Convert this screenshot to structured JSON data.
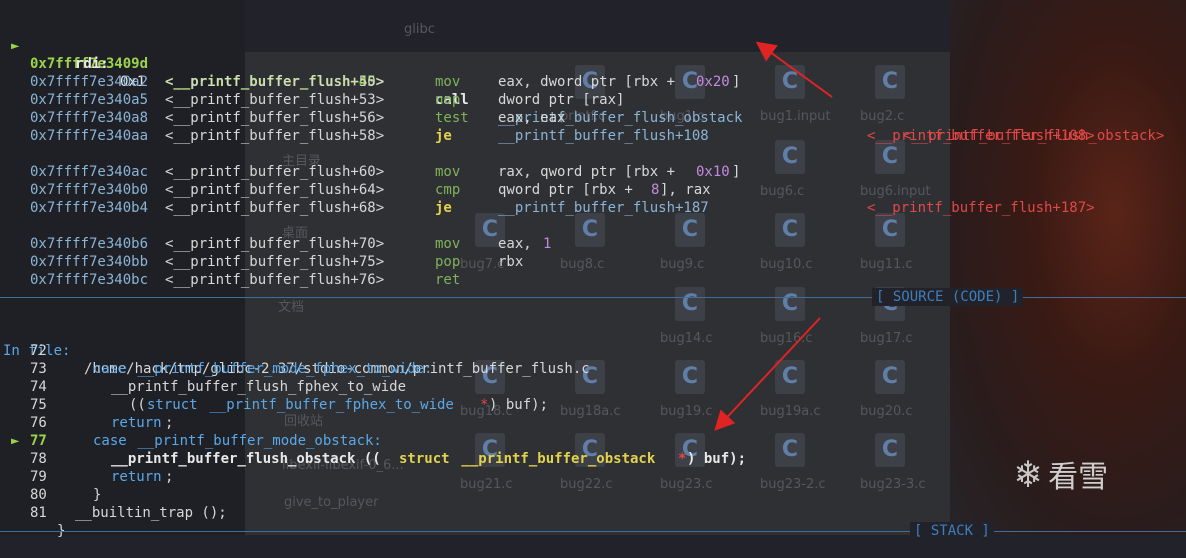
{
  "background": {
    "window_title": "glibc",
    "sidebar_items": [
      "最近使用",
      "主目录",
      "桌面",
      "文档",
      "回收站",
      "libexif-libexif-0_6...",
      "give_to_player"
    ],
    "files": [
      "printf.c",
      "bug1.c",
      "bug1.input",
      "bug2.c",
      "bug6.c",
      "bug6.input",
      "bug7.c",
      "bug8.c",
      "bug9.c",
      "bug10.c",
      "bug11.c",
      "bug14.c",
      "bug16.c",
      "bug17.c",
      "bug18.c",
      "bug18a.c",
      "bug19.c",
      "bug19a.c",
      "bug20.c",
      "bug21.c",
      "bug22.c",
      "bug23.c",
      "bug23-2.c",
      "bug23-3.c"
    ],
    "file_icon_letter": "C"
  },
  "disasm": {
    "current": {
      "marker": "►",
      "addr": "0x7ffff7e3409d",
      "func": "<__printf_buffer_flush+45>",
      "mnemonic": "call",
      "operand": "__printf_buffer_flush_obstack",
      "target": "<__printf_buffer_flush_obstack>"
    },
    "arg": {
      "name": "rdi:",
      "value": "0x1"
    },
    "rows": [
      {
        "addr": "0x7ffff7e340a2",
        "func": "<__printf_buffer_flush+50>",
        "mnemonic": "mov",
        "op_a": "eax, dword ptr [rbx + ",
        "op_num": "0x20",
        "op_b": "]",
        "target": ""
      },
      {
        "addr": "0x7ffff7e340a5",
        "func": "<__printf_buffer_flush+53>",
        "mnemonic": "nop",
        "op_a": "dword ptr [rax]",
        "op_num": "",
        "op_b": "",
        "target": ""
      },
      {
        "addr": "0x7ffff7e340a8",
        "func": "<__printf_buffer_flush+56>",
        "mnemonic": "test",
        "op_a": "eax, eax",
        "op_num": "",
        "op_b": "",
        "target": ""
      },
      {
        "addr": "0x7ffff7e340aa",
        "func": "<__printf_buffer_flush+58>",
        "mnemonic": "je",
        "op_a": "__printf_buffer_flush+108",
        "op_num": "",
        "op_b": "",
        "target": "<__printf_buffer_flush+108>"
      },
      {
        "addr": "0x7ffff7e340ac",
        "func": "<__printf_buffer_flush+60>",
        "mnemonic": "mov",
        "op_a": "rax, qword ptr [rbx + ",
        "op_num": "0x10",
        "op_b": "]",
        "target": ""
      },
      {
        "addr": "0x7ffff7e340b0",
        "func": "<__printf_buffer_flush+64>",
        "mnemonic": "cmp",
        "op_a": "qword ptr [rbx + ",
        "op_num": "8",
        "op_b": "], rax",
        "target": ""
      },
      {
        "addr": "0x7ffff7e340b4",
        "func": "<__printf_buffer_flush+68>",
        "mnemonic": "je",
        "op_a": "__printf_buffer_flush+187",
        "op_num": "",
        "op_b": "",
        "target": "<__printf_buffer_flush+187>"
      },
      {
        "addr": "0x7ffff7e340b6",
        "func": "<__printf_buffer_flush+70>",
        "mnemonic": "mov",
        "op_a": "eax, ",
        "op_num": "1",
        "op_b": "",
        "target": ""
      },
      {
        "addr": "0x7ffff7e340bb",
        "func": "<__printf_buffer_flush+75>",
        "mnemonic": "pop",
        "op_a": "rbx",
        "op_num": "",
        "op_b": "",
        "target": ""
      },
      {
        "addr": "0x7ffff7e340bc",
        "func": "<__printf_buffer_flush+76>",
        "mnemonic": "ret",
        "op_a": "",
        "op_num": "",
        "op_b": "",
        "target": ""
      }
    ]
  },
  "source": {
    "header_label": "[ SOURCE (CODE) ]",
    "file_prefix": "In file: ",
    "file_path": "/home/hack/tmp/glibc-2.37/stdio-common/printf_buffer_flush.c",
    "lines": [
      {
        "num": "72",
        "current": false
      },
      {
        "num": "73",
        "current": false
      },
      {
        "num": "74",
        "current": false
      },
      {
        "num": "75",
        "current": false
      },
      {
        "num": "76",
        "current": false
      },
      {
        "num": "77",
        "current": true
      },
      {
        "num": "78",
        "current": false
      },
      {
        "num": "79",
        "current": false
      },
      {
        "num": "80",
        "current": false
      },
      {
        "num": "81",
        "current": false
      }
    ],
    "code": {
      "l72_kw": "case",
      "l72_rest": " __printf_buffer_mode_fphex_to_wide:",
      "l73": "__printf_buffer_flush_fphex_to_wide",
      "l74_a": "((",
      "l74_kw": "struct",
      "l74_b": " __printf_buffer_fphex_to_wide ",
      "l74_ptr": "*",
      "l74_c": ") buf);",
      "l75_kw": "return",
      "l75_rest": ";",
      "l76_kw": "case",
      "l76_rest": " __printf_buffer_mode_obstack:",
      "l77_a": "__printf_buffer_flush_obstack ((",
      "l77_kw": "struct",
      "l77_b": " __printf_buffer_obstack ",
      "l77_ptr": "*",
      "l77_c": ") buf);",
      "l78_kw": "return",
      "l78_rest": ";",
      "l79": "}",
      "l80": "__builtin_trap ();",
      "l81": "}"
    },
    "current_marker": "►"
  },
  "stack": {
    "header_label": "[ STACK ]"
  },
  "watermark": {
    "text": "看雪"
  },
  "colors": {
    "arrow": "#e02424",
    "separator": "#3f6e9a"
  }
}
